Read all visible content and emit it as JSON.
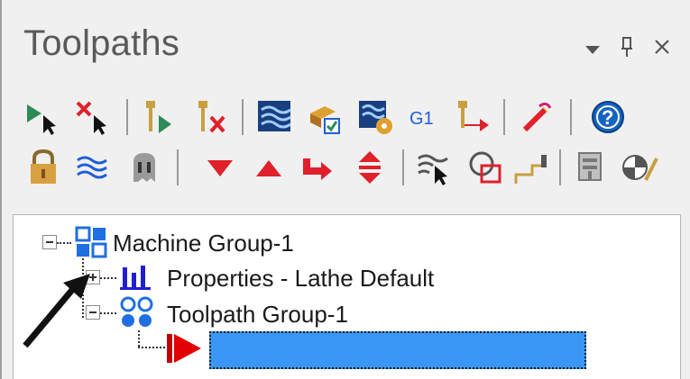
{
  "panel": {
    "title": "Toolpaths",
    "controls": {
      "dropdown_icon": "chevron-down-icon",
      "pin_icon": "pin-icon",
      "close_icon": "close-icon"
    }
  },
  "toolbar_row1": [
    "select-all-operations-icon",
    "deselect-all-operations-icon",
    "regenerate-selected-icon",
    "regenerate-dirty-icon",
    "backplot-icon",
    "verify-icon",
    "simulate-icon",
    "post-selected-g1-icon",
    "highfeed-icon",
    "toolpath-editor-icon",
    "help-icon"
  ],
  "toolbar_row2": [
    "lock-icon",
    "toggle-display-icon",
    "ghost-icon",
    "move-down-icon",
    "move-up-icon",
    "insert-arrow-icon",
    "scroll-insert-icon",
    "display-selected-icon",
    "stock-model-icon",
    "stock-view-icon",
    "setup-sheet-icon",
    "materials-icon"
  ],
  "g1_label": "G1",
  "tree": {
    "machine_group": "Machine Group-1",
    "properties": "Properties - Lathe Default",
    "toolpath_group": "Toolpath Group-1",
    "new_item_name": ""
  },
  "colors": {
    "accent_green": "#2e8b57",
    "red_x": "#e0202a",
    "blue_icon": "#1f5fd6",
    "selection_blue": "#3a96f4",
    "insert_arrow_red": "#e00000",
    "help_blue": "#1564c0"
  }
}
